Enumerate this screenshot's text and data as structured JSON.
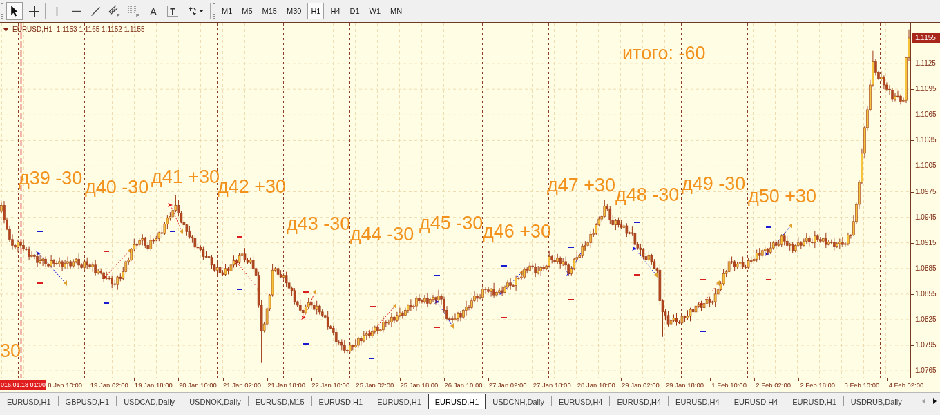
{
  "toolbar": {
    "tools": [
      {
        "kind": "pointer",
        "selected": true
      },
      {
        "kind": "crosshair",
        "selected": false
      },
      {
        "kind": "vertical-line",
        "selected": false
      },
      {
        "kind": "horizontal-line",
        "selected": false
      },
      {
        "kind": "trend-line",
        "selected": false
      },
      {
        "kind": "channel",
        "selected": false,
        "letter": "E"
      },
      {
        "kind": "fibonacci",
        "selected": false,
        "letter": "F"
      },
      {
        "kind": "text",
        "selected": false,
        "label": "A"
      },
      {
        "kind": "text-label",
        "selected": false,
        "letter": "T"
      },
      {
        "kind": "arrows",
        "selected": false
      }
    ],
    "timeframes": [
      {
        "label": "M1",
        "selected": false
      },
      {
        "label": "M5",
        "selected": false
      },
      {
        "label": "M15",
        "selected": false
      },
      {
        "label": "M30",
        "selected": false
      },
      {
        "label": "H1",
        "selected": true
      },
      {
        "label": "H4",
        "selected": false
      },
      {
        "label": "D1",
        "selected": false
      },
      {
        "label": "W1",
        "selected": false
      },
      {
        "label": "MN",
        "selected": false
      }
    ]
  },
  "chart": {
    "symbol": "EURUSD,H1",
    "ohlc": "1.1153 1.1165 1.1152 1.1155",
    "current_price": "1.1155",
    "cursor_time": "016.01.18 01:00",
    "annotations": [
      {
        "text": "30"
      },
      {
        "text": "д39 -30"
      },
      {
        "text": "д40 -30"
      },
      {
        "text": "д41 +30"
      },
      {
        "text": "д42 +30"
      },
      {
        "text": "д43 -30"
      },
      {
        "text": "д44 -30"
      },
      {
        "text": "д45 -30"
      },
      {
        "text": "д46 +30"
      },
      {
        "text": "д47 +30"
      },
      {
        "text": "д48 -30"
      },
      {
        "text": "д49 -30"
      },
      {
        "text": "д50 +30"
      }
    ],
    "total": "итого: -60",
    "chart_data": {
      "type": "candlestick",
      "grid": true,
      "ylim": [
        1.0757,
        1.1172
      ],
      "yticks": [
        1.0765,
        1.0795,
        1.0825,
        1.0855,
        1.0885,
        1.0915,
        1.0945,
        1.0975,
        1.1005,
        1.1035,
        1.1065,
        1.1095,
        1.1125
      ],
      "categories": [
        null,
        null,
        null,
        null,
        null,
        null,
        null,
        null,
        null,
        null,
        null,
        null,
        null,
        null,
        null,
        null,
        null,
        null,
        null,
        null,
        null,
        null,
        null,
        "8 Jan 10:00",
        null,
        null,
        null,
        null,
        null,
        null,
        null,
        null,
        null,
        null,
        null,
        null,
        null,
        null,
        null,
        "19 Jan 02:00",
        null,
        null,
        null,
        null,
        null,
        null,
        null,
        null,
        null,
        null,
        null,
        null,
        null,
        null,
        null,
        "19 Jan 18:00",
        null,
        null,
        null,
        null,
        null,
        null,
        null,
        null,
        null,
        null,
        null,
        null,
        null,
        null,
        null,
        "20 Jan 10:00",
        null,
        null,
        null,
        null,
        null,
        null,
        null,
        null,
        null,
        null,
        null,
        null,
        null,
        null,
        null,
        "21 Jan 02:00",
        null,
        null,
        null,
        null,
        null,
        null,
        null,
        null,
        null,
        null,
        null,
        null,
        null,
        null,
        null,
        "21 Jan 18:00",
        null,
        null,
        null,
        null,
        null,
        null,
        null,
        null,
        null,
        null,
        null,
        null,
        null,
        null,
        null,
        "22 Jan 10:00",
        null,
        null,
        null,
        null,
        null,
        null,
        null,
        null,
        null,
        null,
        null,
        null,
        null,
        null,
        null,
        "25 Jan 02:00",
        null,
        null,
        null,
        null,
        null,
        null,
        null,
        null,
        null,
        null,
        null,
        null,
        null,
        null,
        null,
        "25 Jan 18:00",
        null,
        null,
        null,
        null,
        null,
        null,
        null,
        null,
        null,
        null,
        null,
        null,
        null,
        null,
        null,
        "26 Jan 10:00",
        null,
        null,
        null,
        null,
        null,
        null,
        null,
        null,
        null,
        null,
        null,
        null,
        null,
        null,
        null,
        "27 Jan 02:00",
        null,
        null,
        null,
        null,
        null,
        null,
        null,
        null,
        null,
        null,
        null,
        null,
        null,
        null,
        null,
        "27 Jan 18:00",
        null,
        null,
        null,
        null,
        null,
        null,
        null,
        null,
        null,
        null,
        null,
        null,
        null,
        null,
        null,
        "28 Jan 10:00",
        null,
        null,
        null,
        null,
        null,
        null,
        null,
        null,
        null,
        null,
        null,
        null,
        null,
        null,
        null,
        "29 Jan 02:00",
        null,
        null,
        null,
        null,
        null,
        null,
        null,
        null,
        null,
        null,
        null,
        null,
        null,
        null,
        null,
        "29 Jan 18:00",
        null,
        null,
        null,
        null,
        null,
        null,
        null,
        null,
        null,
        null,
        null,
        null,
        null,
        null,
        null,
        "1 Feb 10:00",
        null,
        null,
        null,
        null,
        null,
        null,
        null,
        null,
        null,
        null,
        null,
        null,
        null,
        null,
        null,
        "2 Feb 02:00",
        null,
        null,
        null,
        null,
        null,
        null,
        null,
        null,
        null,
        null,
        null,
        null,
        null,
        null,
        null,
        "2 Feb 18:00",
        null,
        null,
        null,
        null,
        null,
        null,
        null,
        null,
        null,
        null,
        null,
        null,
        null,
        null,
        null,
        "3 Feb 10:00",
        null,
        null,
        null,
        null,
        null,
        null,
        null,
        null,
        null,
        null,
        null,
        null,
        null,
        null,
        null,
        "4 Feb 02:00",
        null
      ],
      "ohlc": [
        [
          1.0952,
          1.0962,
          1.095,
          1.0959
        ],
        [
          1.0959,
          1.0964,
          1.0938,
          1.0942
        ],
        [
          1.0942,
          1.0944,
          1.093,
          1.0931
        ],
        [
          1.0931,
          1.0935,
          1.0916,
          1.0919
        ],
        [
          1.0919,
          1.0925,
          1.0907,
          1.0912
        ],
        [
          1.0912,
          1.0914,
          1.0908,
          1.091
        ],
        [
          1.091,
          1.0919,
          1.0904,
          1.0916
        ],
        [
          1.0916,
          1.0917,
          1.0909,
          1.0912
        ],
        [
          1.0912,
          1.0919,
          1.0906,
          1.0908
        ],
        [
          1.0908,
          1.091,
          1.0906,
          1.0908
        ],
        [
          1.0908,
          1.0911,
          1.0895,
          1.0899
        ],
        [
          1.0899,
          1.0905,
          1.0898,
          1.09
        ],
        [
          1.09,
          1.0902,
          1.0896,
          1.0899
        ],
        [
          1.0899,
          1.0903,
          1.0887,
          1.0892
        ],
        [
          1.0892,
          1.09,
          1.089,
          1.0894
        ],
        [
          1.0894,
          1.0898,
          1.0888,
          1.0896
        ],
        [
          1.0896,
          1.0899,
          1.0887,
          1.089
        ],
        [
          1.089,
          1.0891,
          1.0886,
          1.0888
        ],
        [
          1.0888,
          1.0901,
          1.0886,
          1.0894
        ],
        [
          1.0894,
          1.0896,
          1.0887,
          1.0891
        ],
        [
          1.0891,
          1.0894,
          1.0889,
          1.089
        ],
        [
          1.089,
          1.0898,
          1.0887,
          1.0893
        ],
        [
          1.0893,
          1.0895,
          1.0882,
          1.0887
        ],
        [
          1.0887,
          1.0895,
          1.0885,
          1.0891
        ],
        [
          1.0891,
          1.0899,
          1.0885,
          1.0893
        ],
        [
          1.0893,
          1.0895,
          1.0885,
          1.0888
        ],
        [
          1.0888,
          1.0896,
          1.0886,
          1.0893
        ],
        [
          1.0893,
          1.0897,
          1.0891,
          1.0896
        ],
        [
          1.0896,
          1.0903,
          1.0885,
          1.0889
        ],
        [
          1.0889,
          1.0891,
          1.0885,
          1.0886
        ],
        [
          1.0886,
          1.0896,
          1.0883,
          1.0893
        ],
        [
          1.0893,
          1.0898,
          1.0884,
          1.0889
        ],
        [
          1.0889,
          1.0891,
          1.0885,
          1.0887
        ],
        [
          1.0887,
          1.0893,
          1.0881,
          1.0889
        ],
        [
          1.0889,
          1.0895,
          1.0877,
          1.088
        ],
        [
          1.088,
          1.0884,
          1.0878,
          1.0882
        ],
        [
          1.0882,
          1.0885,
          1.0878,
          1.088
        ],
        [
          1.088,
          1.0881,
          1.0869,
          1.0873
        ],
        [
          1.0873,
          1.0881,
          1.0872,
          1.0874
        ],
        [
          1.0874,
          1.0876,
          1.0871,
          1.0874
        ],
        [
          1.0874,
          1.0877,
          1.0862,
          1.0867
        ],
        [
          1.0867,
          1.0872,
          1.0864,
          1.0866
        ],
        [
          1.0866,
          1.0877,
          1.086,
          1.0875
        ],
        [
          1.0875,
          1.0879,
          1.087,
          1.0873
        ],
        [
          1.0873,
          1.0887,
          1.0871,
          1.0881
        ],
        [
          1.0881,
          1.0895,
          1.0879,
          1.0893
        ],
        [
          1.0893,
          1.0898,
          1.0889,
          1.0895
        ],
        [
          1.0895,
          1.0909,
          1.0894,
          1.0908
        ],
        [
          1.0908,
          1.092,
          1.0905,
          1.0913
        ],
        [
          1.0913,
          1.0915,
          1.0908,
          1.0913
        ],
        [
          1.0913,
          1.0921,
          1.0911,
          1.0918
        ],
        [
          1.0918,
          1.0925,
          1.0912,
          1.092
        ],
        [
          1.092,
          1.0922,
          1.0909,
          1.0912
        ],
        [
          1.0912,
          1.0916,
          1.0906,
          1.0908
        ],
        [
          1.0908,
          1.0924,
          1.0906,
          1.0918
        ],
        [
          1.0918,
          1.092,
          1.0914,
          1.0918
        ],
        [
          1.0918,
          1.0923,
          1.0917,
          1.092
        ],
        [
          1.092,
          1.0928,
          1.0917,
          1.0927
        ],
        [
          1.0927,
          1.0934,
          1.0921,
          1.0926
        ],
        [
          1.0926,
          1.0939,
          1.0924,
          1.0937
        ],
        [
          1.0937,
          1.0947,
          1.0931,
          1.0944
        ],
        [
          1.0944,
          1.0951,
          1.0941,
          1.0946
        ],
        [
          1.0946,
          1.0955,
          1.0944,
          1.0953
        ],
        [
          1.0953,
          1.0971,
          1.0951,
          1.0959
        ],
        [
          1.0959,
          1.0965,
          1.0946,
          1.095
        ],
        [
          1.095,
          1.0952,
          1.0938,
          1.0939
        ],
        [
          1.0939,
          1.0942,
          1.0933,
          1.0936
        ],
        [
          1.0936,
          1.0937,
          1.0923,
          1.0928
        ],
        [
          1.0928,
          1.0935,
          1.092,
          1.0922
        ],
        [
          1.0922,
          1.0924,
          1.0915,
          1.0921
        ],
        [
          1.0921,
          1.0924,
          1.0907,
          1.091
        ],
        [
          1.091,
          1.0915,
          1.0908,
          1.091
        ],
        [
          1.091,
          1.0912,
          1.0905,
          1.0907
        ],
        [
          1.0907,
          1.0911,
          1.0895,
          1.0899
        ],
        [
          1.0899,
          1.0905,
          1.0898,
          1.0899
        ],
        [
          1.0899,
          1.0901,
          1.0895,
          1.0898
        ],
        [
          1.0898,
          1.0901,
          1.0884,
          1.0889
        ],
        [
          1.0889,
          1.089,
          1.0881,
          1.0883
        ],
        [
          1.0883,
          1.0893,
          1.0877,
          1.0886
        ],
        [
          1.0886,
          1.0888,
          1.0877,
          1.088
        ],
        [
          1.088,
          1.0883,
          1.0876,
          1.0878
        ],
        [
          1.0878,
          1.089,
          1.0876,
          1.0885
        ],
        [
          1.0885,
          1.0887,
          1.0878,
          1.0882
        ],
        [
          1.0882,
          1.0893,
          1.0881,
          1.0889
        ],
        [
          1.0889,
          1.09,
          1.0886,
          1.0894
        ],
        [
          1.0894,
          1.0896,
          1.0887,
          1.0892
        ],
        [
          1.0892,
          1.0903,
          1.089,
          1.09
        ],
        [
          1.09,
          1.0903,
          1.0894,
          1.0902
        ],
        [
          1.0902,
          1.0909,
          1.0892,
          1.0895
        ],
        [
          1.0895,
          1.0897,
          1.089,
          1.0892
        ],
        [
          1.0892,
          1.0898,
          1.089,
          1.0895
        ],
        [
          1.0895,
          1.09,
          1.0881,
          1.0885
        ],
        [
          1.0885,
          1.0887,
          1.0876,
          1.0877
        ],
        [
          1.0877,
          1.0881,
          1.0839,
          1.0842
        ],
        [
          1.0842,
          1.0848,
          1.0775,
          1.0812
        ],
        [
          1.0812,
          1.0822,
          1.081,
          1.082
        ],
        [
          1.082,
          1.0841,
          1.0814,
          1.0838
        ],
        [
          1.0838,
          1.0855,
          1.0835,
          1.0854
        ],
        [
          1.0854,
          1.089,
          1.0852,
          1.0883
        ],
        [
          1.0883,
          1.0887,
          1.0881,
          1.0885
        ],
        [
          1.0885,
          1.0888,
          1.0874,
          1.0878
        ],
        [
          1.0878,
          1.0883,
          1.0874,
          1.0875
        ],
        [
          1.0875,
          1.0879,
          1.0872,
          1.0877
        ],
        [
          1.0877,
          1.0881,
          1.0863,
          1.0868
        ],
        [
          1.0868,
          1.0874,
          1.086,
          1.0862
        ],
        [
          1.0862,
          1.0864,
          1.0853,
          1.0859
        ],
        [
          1.0859,
          1.0862,
          1.0843,
          1.0846
        ],
        [
          1.0846,
          1.0847,
          1.084,
          1.0842
        ],
        [
          1.0842,
          1.0849,
          1.0834,
          1.0836
        ],
        [
          1.0836,
          1.0838,
          1.0829,
          1.0833
        ],
        [
          1.0833,
          1.0843,
          1.0832,
          1.084
        ],
        [
          1.084,
          1.085,
          1.0837,
          1.0845
        ],
        [
          1.0845,
          1.0847,
          1.0837,
          1.0842
        ],
        [
          1.0842,
          1.0846,
          1.0835,
          1.0837
        ],
        [
          1.0837,
          1.0847,
          1.0831,
          1.0841
        ],
        [
          1.0841,
          1.0843,
          1.0831,
          1.0834
        ],
        [
          1.0834,
          1.0837,
          1.0828,
          1.083
        ],
        [
          1.083,
          1.0831,
          1.0826,
          1.0828
        ],
        [
          1.0828,
          1.0835,
          1.0813,
          1.0817
        ],
        [
          1.0817,
          1.0819,
          1.0814,
          1.0815
        ],
        [
          1.0815,
          1.0818,
          1.0807,
          1.081
        ],
        [
          1.081,
          1.0815,
          1.0794,
          1.0799
        ],
        [
          1.0799,
          1.0801,
          1.0796,
          1.0798
        ],
        [
          1.0798,
          1.0802,
          1.0789,
          1.0795
        ],
        [
          1.0795,
          1.0801,
          1.0786,
          1.0789
        ],
        [
          1.0789,
          1.0791,
          1.0786,
          1.0788
        ],
        [
          1.0788,
          1.0798,
          1.0786,
          1.0795
        ],
        [
          1.0795,
          1.0796,
          1.0789,
          1.0793
        ],
        [
          1.0793,
          1.0802,
          1.0792,
          1.0795
        ],
        [
          1.0795,
          1.0805,
          1.0792,
          1.0803
        ],
        [
          1.0803,
          1.0806,
          1.0795,
          1.08
        ],
        [
          1.08,
          1.0812,
          1.0798,
          1.0807
        ],
        [
          1.0807,
          1.0811,
          1.0801,
          1.0809
        ],
        [
          1.0809,
          1.0813,
          1.0803,
          1.0806
        ],
        [
          1.0806,
          1.0817,
          1.0804,
          1.0811
        ],
        [
          1.0811,
          1.0818,
          1.0809,
          1.0816
        ],
        [
          1.0816,
          1.0819,
          1.0808,
          1.0812
        ],
        [
          1.0812,
          1.0814,
          1.0811,
          1.0813
        ],
        [
          1.0813,
          1.0829,
          1.081,
          1.0822
        ],
        [
          1.0822,
          1.0824,
          1.0816,
          1.0821
        ],
        [
          1.0821,
          1.0825,
          1.0819,
          1.0822
        ],
        [
          1.0822,
          1.0833,
          1.0816,
          1.0828
        ],
        [
          1.0828,
          1.083,
          1.0821,
          1.0824
        ],
        [
          1.0824,
          1.0834,
          1.0822,
          1.083
        ],
        [
          1.083,
          1.0839,
          1.0828,
          1.0833
        ],
        [
          1.0833,
          1.0835,
          1.0826,
          1.083
        ],
        [
          1.083,
          1.0839,
          1.0829,
          1.0836
        ],
        [
          1.0836,
          1.0843,
          1.0833,
          1.0842
        ],
        [
          1.0842,
          1.0849,
          1.0835,
          1.084
        ],
        [
          1.084,
          1.0843,
          1.0838,
          1.0841
        ],
        [
          1.0841,
          1.0853,
          1.0835,
          1.085
        ],
        [
          1.085,
          1.0855,
          1.0844,
          1.0847
        ],
        [
          1.0847,
          1.0849,
          1.0844,
          1.0846
        ],
        [
          1.0846,
          1.0854,
          1.0844,
          1.085
        ],
        [
          1.085,
          1.0856,
          1.084,
          1.0844
        ],
        [
          1.0844,
          1.0851,
          1.0843,
          1.0849
        ],
        [
          1.0849,
          1.0854,
          1.0846,
          1.0851
        ],
        [
          1.0851,
          1.0852,
          1.0843,
          1.0848
        ],
        [
          1.0848,
          1.086,
          1.0846,
          1.0853
        ],
        [
          1.0853,
          1.0855,
          1.0843,
          1.0849
        ],
        [
          1.0849,
          1.0852,
          1.0833,
          1.0836
        ],
        [
          1.0836,
          1.0841,
          1.0824,
          1.0826
        ],
        [
          1.0826,
          1.0828,
          1.0824,
          1.0826
        ],
        [
          1.0826,
          1.083,
          1.0821,
          1.0825
        ],
        [
          1.0825,
          1.0832,
          1.0824,
          1.0826
        ],
        [
          1.0826,
          1.0834,
          1.0823,
          1.0832
        ],
        [
          1.0832,
          1.0835,
          1.0823,
          1.0828
        ],
        [
          1.0828,
          1.0837,
          1.0826,
          1.0836
        ],
        [
          1.0836,
          1.0847,
          1.083,
          1.084
        ],
        [
          1.084,
          1.0842,
          1.0836,
          1.0839
        ],
        [
          1.0839,
          1.085,
          1.0837,
          1.0847
        ],
        [
          1.0847,
          1.0858,
          1.0845,
          1.0853
        ],
        [
          1.0853,
          1.0855,
          1.0846,
          1.085
        ],
        [
          1.085,
          1.0855,
          1.0849,
          1.0851
        ],
        [
          1.0851,
          1.0867,
          1.0848,
          1.0861
        ],
        [
          1.0861,
          1.0863,
          1.0855,
          1.086
        ],
        [
          1.086,
          1.0863,
          1.0856,
          1.0858
        ],
        [
          1.0858,
          1.0862,
          1.0852,
          1.0861
        ],
        [
          1.0861,
          1.0868,
          1.0851,
          1.0854
        ],
        [
          1.0854,
          1.0859,
          1.0852,
          1.0857
        ],
        [
          1.0857,
          1.0862,
          1.0855,
          1.0859
        ],
        [
          1.0859,
          1.0864,
          1.0853,
          1.0857
        ],
        [
          1.0857,
          1.0865,
          1.0856,
          1.0863
        ],
        [
          1.0863,
          1.0872,
          1.086,
          1.0868
        ],
        [
          1.0868,
          1.0874,
          1.086,
          1.0865
        ],
        [
          1.0865,
          1.0867,
          1.0863,
          1.0865
        ],
        [
          1.0865,
          1.0877,
          1.0859,
          1.0874
        ],
        [
          1.0874,
          1.0875,
          1.0871,
          1.0874
        ],
        [
          1.0874,
          1.0882,
          1.0872,
          1.0875
        ],
        [
          1.0875,
          1.0886,
          1.0873,
          1.0884
        ],
        [
          1.0884,
          1.0887,
          1.0879,
          1.0883
        ],
        [
          1.0883,
          1.0893,
          1.0882,
          1.0888
        ],
        [
          1.0888,
          1.089,
          1.0884,
          1.0887
        ],
        [
          1.0887,
          1.0891,
          1.0875,
          1.088
        ],
        [
          1.088,
          1.0888,
          1.0878,
          1.0882
        ],
        [
          1.0882,
          1.0888,
          1.0876,
          1.0886
        ],
        [
          1.0886,
          1.0889,
          1.0882,
          1.0885
        ],
        [
          1.0885,
          1.0889,
          1.0883,
          1.0888
        ],
        [
          1.0888,
          1.0906,
          1.0886,
          1.0899
        ],
        [
          1.0899,
          1.0901,
          1.0891,
          1.0895
        ],
        [
          1.0895,
          1.0898,
          1.0892,
          1.0893
        ],
        [
          1.0893,
          1.0902,
          1.089,
          1.0897
        ],
        [
          1.0897,
          1.0899,
          1.0885,
          1.089
        ],
        [
          1.089,
          1.0897,
          1.0888,
          1.0893
        ],
        [
          1.0893,
          1.0899,
          1.0883,
          1.0889
        ],
        [
          1.0889,
          1.0891,
          1.0876,
          1.0879
        ],
        [
          1.0879,
          1.0888,
          1.0877,
          1.0885
        ],
        [
          1.0885,
          1.0897,
          1.0883,
          1.0896
        ],
        [
          1.0896,
          1.0905,
          1.0892,
          1.0898
        ],
        [
          1.0898,
          1.0902,
          1.0897,
          1.09
        ],
        [
          1.09,
          1.0914,
          1.0897,
          1.0911
        ],
        [
          1.0911,
          1.0917,
          1.0906,
          1.0912
        ],
        [
          1.0912,
          1.0917,
          1.091,
          1.0915
        ],
        [
          1.0915,
          1.0929,
          1.0909,
          1.0925
        ],
        [
          1.0925,
          1.0932,
          1.0922,
          1.0926
        ],
        [
          1.0926,
          1.0938,
          1.0924,
          1.0936
        ],
        [
          1.0936,
          1.0946,
          1.0934,
          1.0943
        ],
        [
          1.0943,
          1.0947,
          1.0939,
          1.0946
        ],
        [
          1.0946,
          1.0965,
          1.0945,
          1.0958
        ],
        [
          1.0958,
          1.096,
          1.0952,
          1.0955
        ],
        [
          1.0955,
          1.0958,
          1.0937,
          1.0942
        ],
        [
          1.0942,
          1.0947,
          1.0934,
          1.0936
        ],
        [
          1.0936,
          1.0943,
          1.093,
          1.0941
        ],
        [
          1.0941,
          1.0945,
          1.0933,
          1.0936
        ],
        [
          1.0936,
          1.0942,
          1.0931,
          1.0933
        ],
        [
          1.0933,
          1.0937,
          1.0931,
          1.0935
        ],
        [
          1.0935,
          1.0938,
          1.0922,
          1.0926
        ],
        [
          1.0926,
          1.0928,
          1.0925,
          1.0927
        ],
        [
          1.0927,
          1.0934,
          1.0923,
          1.0926
        ],
        [
          1.0926,
          1.0928,
          1.0908,
          1.0913
        ],
        [
          1.0913,
          1.0916,
          1.0907,
          1.0909
        ],
        [
          1.0909,
          1.0914,
          1.0901,
          1.0907
        ],
        [
          1.0907,
          1.0909,
          1.0896,
          1.0899
        ],
        [
          1.0899,
          1.0903,
          1.0893,
          1.0895
        ],
        [
          1.0895,
          1.0906,
          1.0893,
          1.09
        ],
        [
          1.09,
          1.0902,
          1.0889,
          1.0893
        ],
        [
          1.0893,
          1.0896,
          1.0884,
          1.0885
        ],
        [
          1.0885,
          1.0886,
          1.088,
          1.0883
        ],
        [
          1.0883,
          1.089,
          1.0842,
          1.0847
        ],
        [
          1.0847,
          1.0849,
          1.0805,
          1.0834
        ],
        [
          1.0834,
          1.0837,
          1.0824,
          1.083
        ],
        [
          1.083,
          1.0835,
          1.0817,
          1.082
        ],
        [
          1.082,
          1.0826,
          1.0818,
          1.0824
        ],
        [
          1.0824,
          1.0831,
          1.0822,
          1.0827
        ],
        [
          1.0827,
          1.0833,
          1.0818,
          1.0822
        ],
        [
          1.0822,
          1.0824,
          1.082,
          1.0821
        ],
        [
          1.0821,
          1.0832,
          1.0818,
          1.0829
        ],
        [
          1.0829,
          1.083,
          1.0822,
          1.0827
        ],
        [
          1.0827,
          1.0836,
          1.0825,
          1.0829
        ],
        [
          1.0829,
          1.0839,
          1.0823,
          1.0837
        ],
        [
          1.0837,
          1.084,
          1.0831,
          1.0834
        ],
        [
          1.0834,
          1.0846,
          1.0832,
          1.0841
        ],
        [
          1.0841,
          1.0845,
          1.0839,
          1.0843
        ],
        [
          1.0843,
          1.0847,
          1.0835,
          1.0839
        ],
        [
          1.0839,
          1.085,
          1.0838,
          1.0844
        ],
        [
          1.0844,
          1.0851,
          1.0841,
          1.0849
        ],
        [
          1.0849,
          1.0852,
          1.084,
          1.0845
        ],
        [
          1.0845,
          1.0847,
          1.0843,
          1.0846
        ],
        [
          1.0846,
          1.0862,
          1.084,
          1.0855
        ],
        [
          1.0855,
          1.0862,
          1.0852,
          1.086
        ],
        [
          1.086,
          1.087,
          1.0858,
          1.0867
        ],
        [
          1.0867,
          1.0884,
          1.0865,
          1.0879
        ],
        [
          1.0879,
          1.0883,
          1.0875,
          1.0881
        ],
        [
          1.0881,
          1.0897,
          1.088,
          1.0893
        ],
        [
          1.0893,
          1.0899,
          1.089,
          1.0893
        ],
        [
          1.0893,
          1.0895,
          1.0882,
          1.0887
        ],
        [
          1.0887,
          1.0893,
          1.0885,
          1.089
        ],
        [
          1.089,
          1.0893,
          1.0884,
          1.0892
        ],
        [
          1.0892,
          1.0899,
          1.0884,
          1.0887
        ],
        [
          1.0887,
          1.0889,
          1.0884,
          1.0886
        ],
        [
          1.0886,
          1.0897,
          1.0884,
          1.0894
        ],
        [
          1.0894,
          1.0899,
          1.089,
          1.0894
        ],
        [
          1.0894,
          1.0898,
          1.0893,
          1.0896
        ],
        [
          1.0896,
          1.0907,
          1.0893,
          1.0903
        ],
        [
          1.0903,
          1.0909,
          1.0895,
          1.09
        ],
        [
          1.09,
          1.0908,
          1.0898,
          1.0906
        ],
        [
          1.0906,
          1.0911,
          1.09,
          1.0908
        ],
        [
          1.0908,
          1.0909,
          1.0901,
          1.0904
        ],
        [
          1.0904,
          1.0916,
          1.0902,
          1.0909
        ],
        [
          1.0909,
          1.0917,
          1.0907,
          1.0915
        ],
        [
          1.0915,
          1.0918,
          1.0908,
          1.0912
        ],
        [
          1.0912,
          1.0918,
          1.0911,
          1.0913
        ],
        [
          1.0913,
          1.0925,
          1.091,
          1.0923
        ],
        [
          1.0923,
          1.0927,
          1.0912,
          1.0917
        ],
        [
          1.0917,
          1.0923,
          1.091,
          1.0912
        ],
        [
          1.0912,
          1.0915,
          1.0906,
          1.0913
        ],
        [
          1.0913,
          1.0916,
          1.0903,
          1.0906
        ],
        [
          1.0906,
          1.0913,
          1.0904,
          1.0912
        ],
        [
          1.0912,
          1.0922,
          1.091,
          1.0915
        ],
        [
          1.0915,
          1.0917,
          1.0908,
          1.0912
        ],
        [
          1.0912,
          1.092,
          1.0911,
          1.0917
        ],
        [
          1.0917,
          1.0926,
          1.0914,
          1.0921
        ],
        [
          1.0921,
          1.0923,
          1.0911,
          1.0916
        ],
        [
          1.0916,
          1.092,
          1.0913,
          1.0915
        ],
        [
          1.0915,
          1.0929,
          1.0909,
          1.0923
        ],
        [
          1.0923,
          1.0925,
          1.0916,
          1.0919
        ],
        [
          1.0919,
          1.0922,
          1.0915,
          1.0917
        ],
        [
          1.0917,
          1.0921,
          1.0915,
          1.092
        ],
        [
          1.092,
          1.0927,
          1.0909,
          1.0913
        ],
        [
          1.0913,
          1.0918,
          1.0912,
          1.0916
        ],
        [
          1.0916,
          1.0919,
          1.0913,
          1.0916
        ],
        [
          1.0916,
          1.0921,
          1.0906,
          1.0911
        ],
        [
          1.0911,
          1.0916,
          1.0909,
          1.0914
        ],
        [
          1.0914,
          1.092,
          1.0908,
          1.0916
        ],
        [
          1.0916,
          1.0922,
          1.091,
          1.0913
        ],
        [
          1.0913,
          1.0916,
          1.0911,
          1.0914
        ],
        [
          1.0914,
          1.0927,
          1.0912,
          1.0924
        ],
        [
          1.0924,
          1.0925,
          1.092,
          1.0924
        ],
        [
          1.0924,
          1.0947,
          1.0923,
          1.094
        ],
        [
          1.094,
          1.0962,
          1.0937,
          1.096
        ],
        [
          1.096,
          1.0989,
          1.0955,
          1.0986
        ],
        [
          1.0986,
          1.1025,
          1.0984,
          1.102
        ],
        [
          1.102,
          1.1052,
          1.1014,
          1.105
        ],
        [
          1.105,
          1.1075,
          1.1047,
          1.1071
        ],
        [
          1.1071,
          1.1106,
          1.1069,
          1.11
        ],
        [
          1.11,
          1.114,
          1.1098,
          1.1127
        ],
        [
          1.1127,
          1.113,
          1.1111,
          1.1115
        ],
        [
          1.1115,
          1.1116,
          1.1106,
          1.1107
        ],
        [
          1.1107,
          1.1116,
          1.1104,
          1.1109
        ],
        [
          1.1109,
          1.1111,
          1.1095,
          1.11
        ],
        [
          1.11,
          1.1103,
          1.1093,
          1.1095
        ],
        [
          1.1095,
          1.11,
          1.1088,
          1.1094
        ],
        [
          1.1094,
          1.1096,
          1.108,
          1.1083
        ],
        [
          1.1083,
          1.1091,
          1.1081,
          1.1087
        ],
        [
          1.1087,
          1.1093,
          1.1085,
          1.1087
        ],
        [
          1.1087,
          1.1089,
          1.1077,
          1.1081
        ],
        [
          1.1081,
          1.1085,
          1.108,
          1.1082
        ],
        [
          1.1082,
          1.1133,
          1.1079,
          1.1132
        ],
        [
          1.1132,
          1.1165,
          1.1128,
          1.1155
        ]
      ]
    }
  },
  "tabs": [
    {
      "label": "EURUSD,H1",
      "selected": false
    },
    {
      "label": "GBPUSD,H1",
      "selected": false
    },
    {
      "label": "USDCAD,Daily",
      "selected": false
    },
    {
      "label": "USDNOK,Daily",
      "selected": false
    },
    {
      "label": "EURUSD,M15",
      "selected": false
    },
    {
      "label": "EURUSD,H1",
      "selected": false
    },
    {
      "label": "EURUSD,H1",
      "selected": false
    },
    {
      "label": "EURUSD,H1",
      "selected": true
    },
    {
      "label": "USDCNH,Daily",
      "selected": false
    },
    {
      "label": "EURUSD,H4",
      "selected": false
    },
    {
      "label": "EURUSD,H4",
      "selected": false
    },
    {
      "label": "EURUSD,H4",
      "selected": false
    },
    {
      "label": "EURUSD,H4",
      "selected": false
    },
    {
      "label": "EURUSD,H1",
      "selected": false
    },
    {
      "label": "USDRUB,Daily",
      "selected": false
    }
  ]
}
